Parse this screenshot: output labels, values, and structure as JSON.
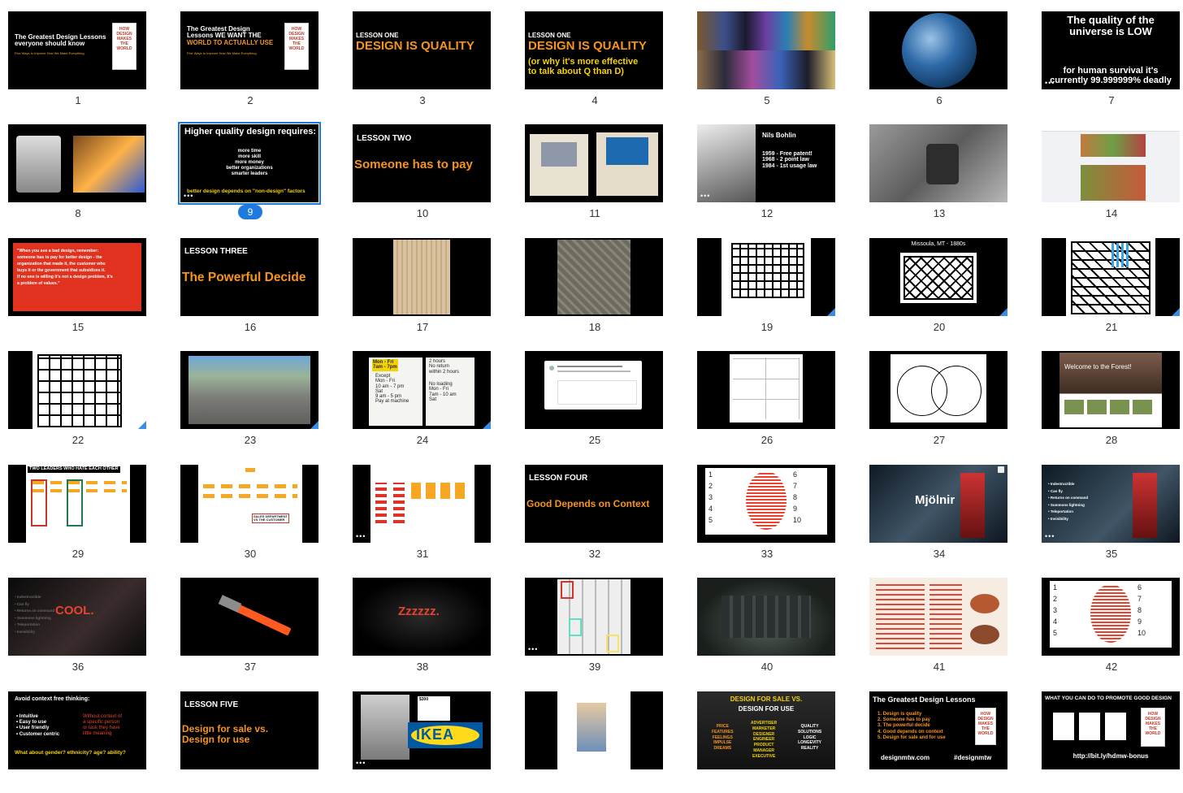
{
  "colors": {
    "accent": "#f7941d",
    "select": "#1f7ae0",
    "yellow": "#f5d300",
    "red": "#e8432e"
  },
  "slides": [
    {
      "n": "1",
      "lines": [
        "The Greatest Design Lessons",
        "everyone should know",
        "Five Ways to Improve How We Make Everything"
      ],
      "book": [
        "HOW",
        "DESIGN",
        "MAKES",
        "THE",
        "WORLD"
      ]
    },
    {
      "n": "2",
      "lines": [
        "The Greatest Design",
        "Lessons WE WANT THE",
        "WORLD TO ACTUALLY USE",
        "Five Ways to Improve How We Make Everything"
      ],
      "book": [
        "HOW",
        "DESIGN",
        "MAKES",
        "THE",
        "WORLD"
      ]
    },
    {
      "n": "3",
      "lines": [
        "LESSON ONE",
        "DESIGN IS QUALITY"
      ]
    },
    {
      "n": "4",
      "lines": [
        "LESSON ONE",
        "DESIGN IS QUALITY",
        "(or why it's more effective",
        "to talk about Q than D)"
      ]
    },
    {
      "n": "5",
      "image": "phones-collage"
    },
    {
      "n": "6",
      "image": "earth"
    },
    {
      "n": "7",
      "lines": [
        "The quality of the",
        "universe is LOW",
        "for human survival it's",
        "currently 99.999999% deadly"
      ]
    },
    {
      "n": "8",
      "image": "old-phone-vs-smartphone"
    },
    {
      "n": "9",
      "lines": [
        "Higher quality design requires:",
        "more time",
        "more skill",
        "more money",
        "better organizations",
        "smarter leaders",
        "better design depends on \"non-design\" factors"
      ],
      "selected": true
    },
    {
      "n": "10",
      "lines": [
        "LESSON TWO",
        "Someone has to pay"
      ]
    },
    {
      "n": "11",
      "image": "macintosh-and-pc"
    },
    {
      "n": "12",
      "lines": [
        "Nils Bohlin",
        "1959 - Free patent!",
        "1968 - 2 point law",
        "1984 - 1st usage law"
      ]
    },
    {
      "n": "13",
      "image": "seatbelt"
    },
    {
      "n": "14",
      "image": "facebook-feed"
    },
    {
      "n": "15",
      "lines": [
        "\"When you see a bad design, remember:",
        "someone has to pay for better design - the",
        "organization that made it, the customer who",
        "buys it or the government that subsidizes it.",
        "If no one is willing it's not a design problem, it's",
        "a problem of values.\""
      ]
    },
    {
      "n": "16",
      "lines": [
        "LESSON THREE",
        "The Powerful Decide"
      ]
    },
    {
      "n": "17",
      "image": "old-map"
    },
    {
      "n": "18",
      "image": "aerial-photo"
    },
    {
      "n": "19",
      "image": "street-map-sketch"
    },
    {
      "n": "20",
      "lines": [
        "Missoula, MT - 1880s"
      ],
      "image": "street-map-sketch"
    },
    {
      "n": "21",
      "image": "street-map-sketch"
    },
    {
      "n": "22",
      "image": "street-map-sketch"
    },
    {
      "n": "23",
      "image": "intersection-photo"
    },
    {
      "n": "24",
      "lines": [
        "Mon - Fri",
        "7am - 7pm",
        "2 hours",
        "No return",
        "within 2 hours",
        "Except",
        "Mon - Fri",
        "10 am - 7 pm",
        "Sat",
        "9 am - 5 pm",
        "Pay at machine",
        "No loading",
        "Mon - Fri",
        "7am - 10 am",
        "Sat"
      ]
    },
    {
      "n": "25",
      "image": "tweet"
    },
    {
      "n": "26",
      "image": "diagram-sketches"
    },
    {
      "n": "27",
      "image": "venn-diagram"
    },
    {
      "n": "28",
      "lines": [
        "Welcome to the Forest!"
      ]
    },
    {
      "n": "29",
      "lines": [
        "TWO LEADERS WHO HATE EACH OTHER"
      ]
    },
    {
      "n": "30",
      "lines": [
        "SALES DEPARTMENT",
        "VS THE CUSTOMER"
      ]
    },
    {
      "n": "31",
      "image": "org-chart"
    },
    {
      "n": "32",
      "lines": [
        "LESSON FOUR",
        "Good Depends on Context"
      ]
    },
    {
      "n": "33",
      "items": [
        "1",
        "2",
        "3",
        "4",
        "5",
        "6",
        "7",
        "8",
        "9",
        "10"
      ]
    },
    {
      "n": "34",
      "lines": [
        "Mjölnir"
      ]
    },
    {
      "n": "35",
      "lines": [
        "Indestructible",
        "Can fly",
        "Returns on command",
        "Summons lightning",
        "Teleportation",
        "Invisibility"
      ]
    },
    {
      "n": "36",
      "lines": [
        "Indestructible",
        "Can fly",
        "Returns on command",
        "Summons lightning",
        "Teleportation",
        "Invisibility",
        "COOL."
      ]
    },
    {
      "n": "37",
      "image": "hammer"
    },
    {
      "n": "38",
      "lines": [
        "Zzzzzz."
      ]
    },
    {
      "n": "39",
      "image": "hammer-collection"
    },
    {
      "n": "40",
      "image": "cockpit"
    },
    {
      "n": "41",
      "image": "menu"
    },
    {
      "n": "42",
      "items": [
        "1",
        "2",
        "3",
        "4",
        "5",
        "6",
        "7",
        "8",
        "9",
        "10"
      ]
    },
    {
      "n": "43",
      "lines": [
        "Avoid context free thinking:",
        "Intuitive",
        "Easy to use",
        "User friendly",
        "Customer centric",
        "Without context of",
        "a specific person",
        "or task they have",
        "little meaning",
        "What about gender? ethnicity? age? ability?"
      ]
    },
    {
      "n": "44",
      "lines": [
        "LESSON FIVE",
        "Design for sale vs.",
        "Design for use"
      ]
    },
    {
      "n": "45",
      "lines": [
        "IKEA",
        "$300"
      ]
    },
    {
      "n": "46",
      "image": "cartoon"
    },
    {
      "n": "47",
      "lines": [
        "DESIGN FOR SALE VS.",
        "DESIGN FOR USE",
        "PRICE",
        "FEATURES",
        "FEELINGS",
        "IMPULSE",
        "DREAMS",
        "ADVERTISER",
        "MARKETER",
        "DESIGNER",
        "ENGINEER",
        "PRODUCT",
        "MANAGER",
        "EXECUTIVE",
        "QUALITY",
        "SOLUTIONS",
        "LOGIC",
        "LONGEVITY",
        "REALITY"
      ]
    },
    {
      "n": "48",
      "lines": [
        "The Greatest Design Lessons",
        "1. Design is quality",
        "2. Someone has to pay",
        "3. The powerful decide",
        "4. Good depends on context",
        "5. Design for sale and for use",
        "designmtw.com",
        "#designmtw"
      ],
      "book": [
        "HOW",
        "DESIGN",
        "MAKES",
        "THE",
        "WORLD"
      ]
    },
    {
      "n": "49",
      "lines": [
        "WHAT YOU CAN DO TO PROMOTE GOOD DESIGN",
        "http://bit.ly/hdmw-bonus"
      ]
    }
  ]
}
